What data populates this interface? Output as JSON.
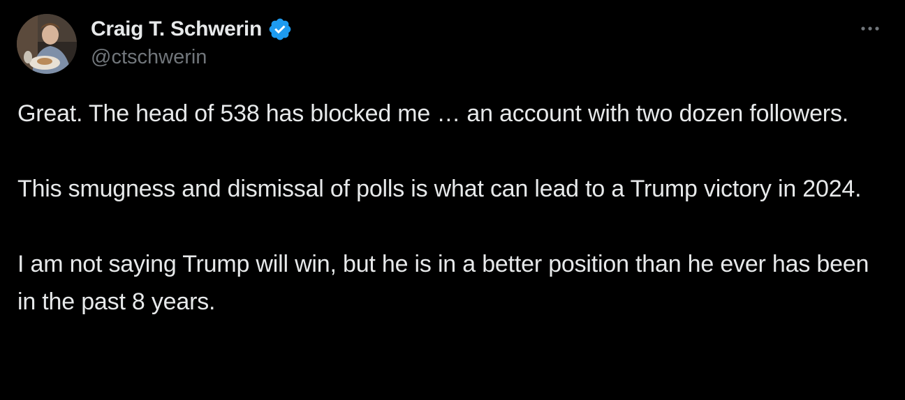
{
  "author": {
    "display_name": "Craig T. Schwerin",
    "handle": "@ctschwerin",
    "verified_icon": "verified-badge-icon",
    "badge_color": "#1d9bf0"
  },
  "menu": {
    "more_icon": "more-horizontal-icon"
  },
  "tweet": {
    "paragraphs": [
      "Great. The head of 538 has blocked me … an account with two dozen followers.",
      "This smugness and dismissal of polls is what can lead to a Trump victory in 2024.",
      "I am not saying Trump will win, but he is in a better position than he ever has been in the past 8 years."
    ]
  },
  "colors": {
    "background": "#000000",
    "text": "#e7e9ea",
    "secondary_text": "#71767b"
  }
}
